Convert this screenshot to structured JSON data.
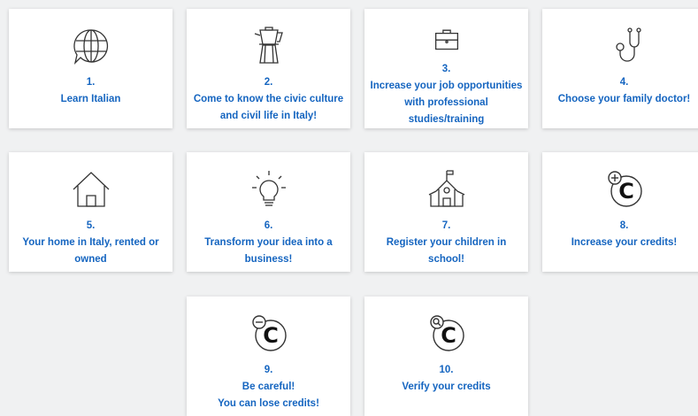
{
  "colors": {
    "label": "#1565c0",
    "card_bg": "#ffffff",
    "page_bg": "#f0f1f2",
    "icon_stroke": "#333333"
  },
  "cards": [
    {
      "number": "1.",
      "lines": [
        "Learn Italian"
      ],
      "icon": "globe-speech-bubble-icon"
    },
    {
      "number": "2.",
      "lines": [
        "Come to know the civic culture",
        "and civil life in Italy!"
      ],
      "icon": "moka-pot-icon"
    },
    {
      "number": "3.",
      "lines": [
        "Increase your job opportunities",
        "with professional studies/training"
      ],
      "icon": "briefcase-icon"
    },
    {
      "number": "4.",
      "lines": [
        "Choose your family doctor!"
      ],
      "icon": "stethoscope-icon"
    },
    {
      "number": "5.",
      "lines": [
        "Your home in Italy, rented or",
        "owned"
      ],
      "icon": "house-icon"
    },
    {
      "number": "6.",
      "lines": [
        "Transform your idea into a",
        "business!"
      ],
      "icon": "lightbulb-icon"
    },
    {
      "number": "7.",
      "lines": [
        "Register your children in school!"
      ],
      "icon": "school-icon"
    },
    {
      "number": "8.",
      "lines": [
        "Increase your credits!"
      ],
      "icon": "credit-plus-icon",
      "letter": "C"
    },
    {
      "number": "9.",
      "lines": [
        "Be careful!",
        "You can lose credits!"
      ],
      "icon": "credit-minus-icon",
      "letter": "C"
    },
    {
      "number": "10.",
      "lines": [
        "Verify your credits"
      ],
      "icon": "credit-search-icon",
      "letter": "C"
    }
  ]
}
